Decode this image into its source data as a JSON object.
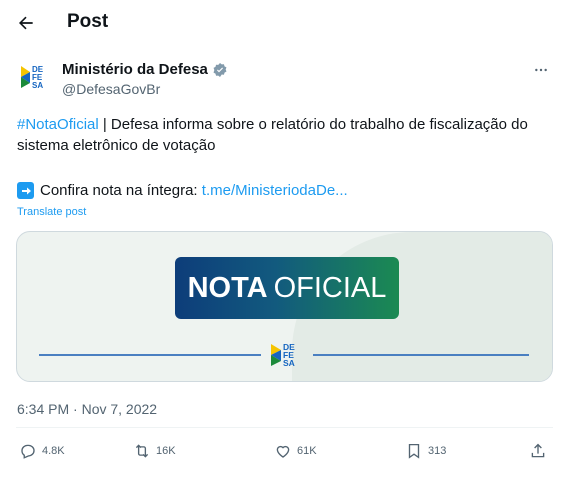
{
  "header": {
    "title": "Post"
  },
  "author": {
    "name": "Ministério da Defesa",
    "handle": "@DefesaGovBr"
  },
  "tweet": {
    "hashtag": "#NotaOficial",
    "text_rest": " | Defesa informa sobre o relatório do trabalho de fiscalização do sistema eletrônico de votação",
    "line2_text": "Confira nota na íntegra: ",
    "line2_link": "t.me/MinisteriodaDe...",
    "translate": "Translate post"
  },
  "card": {
    "nota_bold": "NOTA",
    "nota_light": "OFICIAL"
  },
  "logo": {
    "line1": "DE",
    "line2": "FE",
    "line3": "SA"
  },
  "timestamp": "6:34 PM · Nov 7, 2022",
  "actions": {
    "replies": "4.8K",
    "reposts": "16K",
    "likes": "61K",
    "bookmarks": "313"
  },
  "colors": {
    "accent": "#1d9bf0",
    "muted": "#536471",
    "logo_blue": "#1565c0",
    "logo_yellow": "#f5c400",
    "logo_green": "#1b8a3a"
  },
  "icons": [
    "back-arrow-icon",
    "verified-badge-icon",
    "more-icon",
    "arrow-right-icon",
    "reply-icon",
    "repost-icon",
    "like-icon",
    "bookmark-icon",
    "share-icon"
  ]
}
